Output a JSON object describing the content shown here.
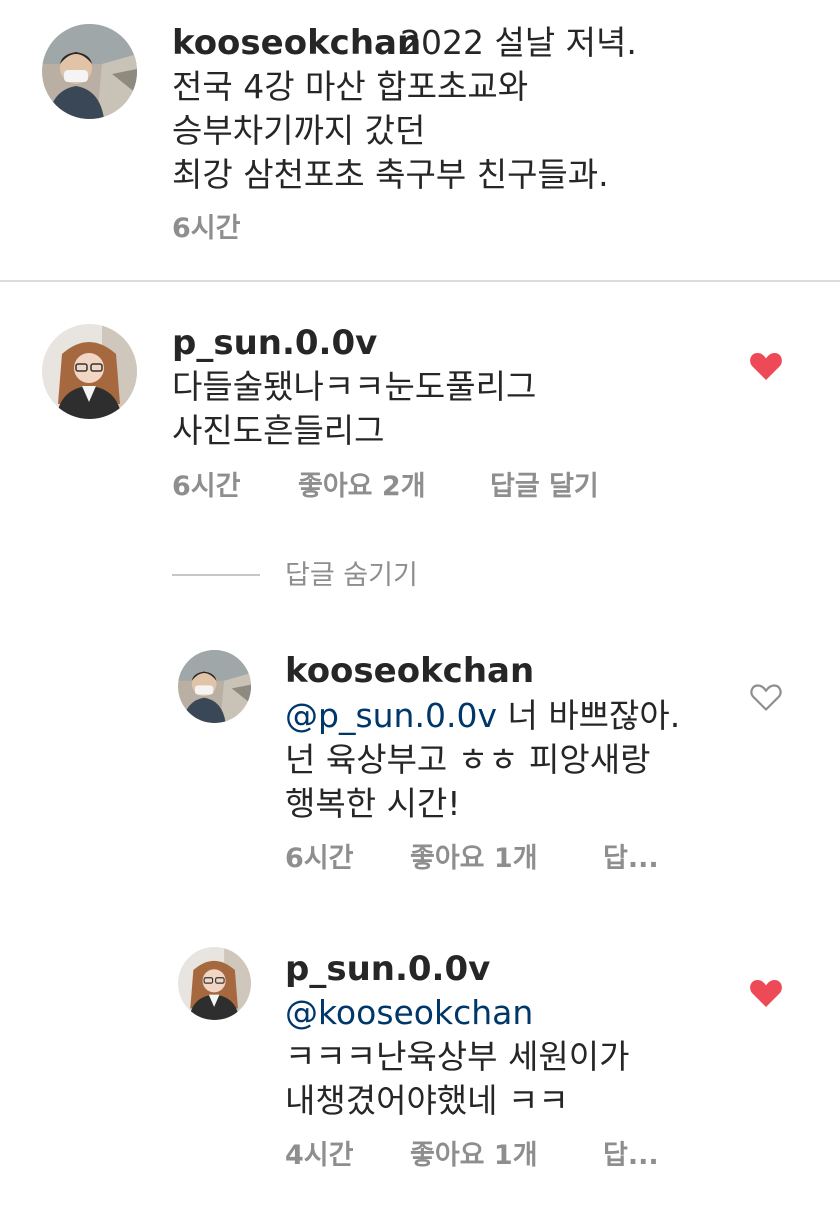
{
  "caption": {
    "username": "kooseokchan",
    "lines": [
      "2022 설날 저녁.",
      "전국 4강 마산 합포초교와",
      "승부차기까지 갔던",
      "최강 삼천포초 축구부 친구들과."
    ],
    "time": "6시간"
  },
  "comment1": {
    "username": "p_sun.0.0v",
    "lines": [
      "다들술됐나ㅋㅋ눈도풀리그",
      "사진도흔들리그"
    ],
    "time": "6시간",
    "likes": "좋아요 2개",
    "reply_label": "답글 달기",
    "liked": true
  },
  "hide_replies_label": "답글 숨기기",
  "reply1": {
    "username": "kooseokchan",
    "mention": "@p_sun.0.0v",
    "line1_rest": " 너 바쁘잖아.",
    "lines": [
      "넌 육상부고 ㅎㅎ 피앙새랑",
      "행복한 시간!"
    ],
    "time": "6시간",
    "likes": "좋아요 1개",
    "reply_label": "답...",
    "liked": false
  },
  "reply2": {
    "username": "p_sun.0.0v",
    "mention": "@kooseokchan",
    "lines": [
      "ㅋㅋㅋ난육상부  세원이가",
      "내챙겼어야했네 ㅋㅋ"
    ],
    "time": "4시간",
    "likes": "좋아요 1개",
    "reply_label": "답...",
    "liked": true
  },
  "colors": {
    "heart_liked": "#ed4956",
    "mention": "#00376b",
    "meta": "#8e8e8e"
  }
}
